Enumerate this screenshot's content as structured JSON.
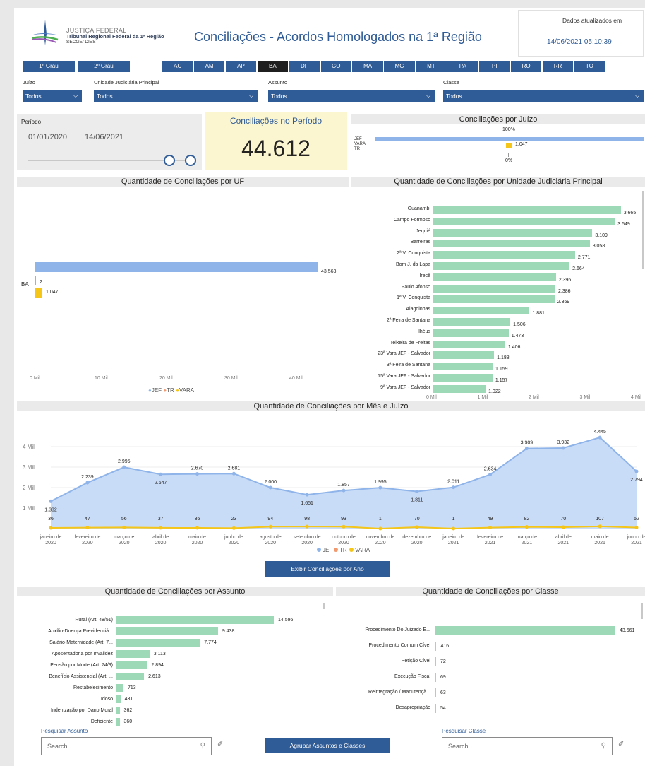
{
  "header": {
    "logo_line1": "JUSTIÇA FEDERAL",
    "logo_line2": "Tribunal Regional Federal da 1ª Região",
    "logo_line3": "SECGE/ DIEST",
    "title": "Conciliações - Acordos Homologados na 1ª Região",
    "updated_label": "Dados atualizados em",
    "updated_value": "14/06/2021 05:10:39"
  },
  "grau_buttons": [
    "1º Grau",
    "2º Grau"
  ],
  "uf_buttons": [
    "AC",
    "AM",
    "AP",
    "BA",
    "DF",
    "GO",
    "MA",
    "MG",
    "MT",
    "PA",
    "PI",
    "RO",
    "RR",
    "TO"
  ],
  "uf_active": "BA",
  "filters": [
    {
      "label": "Juízo",
      "value": "Todos"
    },
    {
      "label": "Unidade Judiciária Principal",
      "value": "Todos"
    },
    {
      "label": "Assunto",
      "value": "Todos"
    },
    {
      "label": "Classe",
      "value": "Todos"
    }
  ],
  "period": {
    "label": "Período",
    "start": "01/01/2020",
    "end": "14/06/2021"
  },
  "kpi": {
    "title": "Conciliações no Período",
    "value": "44.612"
  },
  "juizo_chart": {
    "title": "Conciliações por Juízo",
    "top_pct": "100%",
    "bottom_pct": "0%",
    "categories": [
      "JEF",
      "VARA",
      "TR"
    ],
    "vara_label": "1.047"
  },
  "uf_chart": {
    "title": "Quantidade de Conciliações por UF",
    "category": "BA",
    "labels": [
      "43.563",
      "2",
      "1.047"
    ],
    "ticks": [
      "0 Mil",
      "10 Mil",
      "20 Mil",
      "30 Mil",
      "40 Mil"
    ],
    "legend": [
      "JEF",
      "TR",
      "VARA"
    ]
  },
  "unidade_chart": {
    "title": "Quantidade de Conciliações por Unidade Judiciária Principal",
    "ticks": [
      "0 Mil",
      "1 Mil",
      "2 Mil",
      "3 Mil",
      "4 Mil"
    ],
    "items": [
      {
        "name": "Guanambi",
        "label": "3.665"
      },
      {
        "name": "Campo Formoso",
        "label": "3.549"
      },
      {
        "name": "Jequié",
        "label": "3.109"
      },
      {
        "name": "Barreiras",
        "label": "3.058"
      },
      {
        "name": "2ª V. Conquista",
        "label": "2.771"
      },
      {
        "name": "Bom J. da Lapa",
        "label": "2.664"
      },
      {
        "name": "Irecê",
        "label": "2.396"
      },
      {
        "name": "Paulo Afonso",
        "label": "2.386"
      },
      {
        "name": "1ª V. Conquista",
        "label": "2.369"
      },
      {
        "name": "Alagoinhas",
        "label": "1.881"
      },
      {
        "name": "2ª Feira de Santana",
        "label": "1.506"
      },
      {
        "name": "Ilhéus",
        "label": "1.473"
      },
      {
        "name": "Teixeira de Freitas",
        "label": "1.406"
      },
      {
        "name": "23ª Vara JEF - Salvador",
        "label": "1.188"
      },
      {
        "name": "3ª Feira de Santana",
        "label": "1.159"
      },
      {
        "name": "15ª Vara JEF - Salvador",
        "label": "1.157"
      },
      {
        "name": "9ª Vara JEF - Salvador",
        "label": "1.022"
      }
    ]
  },
  "mes_chart": {
    "title": "Quantidade de Conciliações por Mês e Juízo",
    "yticks": [
      "1 Mil",
      "2 Mil",
      "3 Mil",
      "4 Mil"
    ],
    "months": [
      "janeiro de 2020",
      "fevereiro de 2020",
      "março de 2020",
      "abril de 2020",
      "maio de 2020",
      "junho de 2020",
      "agosto de 2020",
      "setembro de 2020",
      "outubro de 2020",
      "novembro de 2020",
      "dezembro de 2020",
      "janeiro de 2021",
      "fevereiro de 2021",
      "março de 2021",
      "abril de 2021",
      "maio de 2021",
      "junho de 2021"
    ],
    "jef_labels": [
      "1.332",
      "2.239",
      "2.995",
      "2.647",
      "2.670",
      "2.681",
      "2.000",
      "1.651",
      "1.857",
      "1.995",
      "1.811",
      "2.011",
      "2.634",
      "3.909",
      "3.932",
      "4.445",
      "2.794"
    ],
    "vara_labels": [
      "36",
      "47",
      "56",
      "37",
      "36",
      "23",
      "94",
      "98",
      "93",
      "1",
      "70",
      "1",
      "49",
      "82",
      "70",
      "107",
      "52"
    ],
    "legend": [
      "JEF",
      "TR",
      "VARA"
    ]
  },
  "btn_ano": "Exibir Conciliações por Ano",
  "assunto_chart": {
    "title": "Quantidade de Conciliações por Assunto",
    "items": [
      {
        "name": "Rural (Art. 48/51)",
        "label": "14.596"
      },
      {
        "name": "Auxílio-Doença Previdenciá...",
        "label": "9.438"
      },
      {
        "name": "Salário-Maternidade (Art. 7...",
        "label": "7.774"
      },
      {
        "name": "Aposentadoria por Invalidez",
        "label": "3.113"
      },
      {
        "name": "Pensão por Morte (Art. 74/9)",
        "label": "2.894"
      },
      {
        "name": "Benefício Assistencial (Art. ...",
        "label": "2.613"
      },
      {
        "name": "Restabelecimento",
        "label": "713"
      },
      {
        "name": "Idoso",
        "label": "431"
      },
      {
        "name": "Indenização por Dano Moral",
        "label": "362"
      },
      {
        "name": "Deficiente",
        "label": "360"
      }
    ]
  },
  "classe_chart": {
    "title": "Quantidade de Conciliações por Classe",
    "items": [
      {
        "name": "Procedimento Do Juizado E...",
        "label": "43.661"
      },
      {
        "name": "Procedimento Comum Cível",
        "label": "416"
      },
      {
        "name": "Petição Cível",
        "label": "72"
      },
      {
        "name": "Execução Fiscal",
        "label": "69"
      },
      {
        "name": "Reintegração / Manutençã...",
        "label": "63"
      },
      {
        "name": "Desapropriação",
        "label": "54"
      }
    ]
  },
  "search_assunto": {
    "label": "Pesquisar Assunto",
    "placeholder": "Search"
  },
  "search_classe": {
    "label": "Pesquisar Classe",
    "placeholder": "Search"
  },
  "btn_agrupar": "Agrupar Assuntos e Classes",
  "colors": {
    "jef": "#8fb4ea",
    "tr": "#f29a6f",
    "vara": "#f5c518",
    "green": "#9dd9b6",
    "button": "#2f5b96"
  },
  "chart_data": [
    {
      "type": "bar",
      "title": "Quantidade de Conciliações por UF",
      "categories": [
        "BA"
      ],
      "series": [
        {
          "name": "JEF",
          "values": [
            43563
          ]
        },
        {
          "name": "TR",
          "values": [
            2
          ]
        },
        {
          "name": "VARA",
          "values": [
            1047
          ]
        }
      ],
      "xlim": [
        0,
        45000
      ]
    },
    {
      "type": "bar",
      "title": "Quantidade de Conciliações por Unidade Judiciária Principal",
      "categories": [
        "Guanambi",
        "Campo Formoso",
        "Jequié",
        "Barreiras",
        "2ª V. Conquista",
        "Bom J. da Lapa",
        "Irecê",
        "Paulo Afonso",
        "1ª V. Conquista",
        "Alagoinhas",
        "2ª Feira de Santana",
        "Ilhéus",
        "Teixeira de Freitas",
        "23ª Vara JEF - Salvador",
        "3ª Feira de Santana",
        "15ª Vara JEF - Salvador",
        "9ª Vara JEF - Salvador"
      ],
      "values": [
        3665,
        3549,
        3109,
        3058,
        2771,
        2664,
        2396,
        2386,
        2369,
        1881,
        1506,
        1473,
        1406,
        1188,
        1159,
        1157,
        1022
      ],
      "xlim": [
        0,
        4000
      ]
    },
    {
      "type": "area",
      "title": "Quantidade de Conciliações por Mês e Juízo",
      "series": [
        {
          "name": "JEF",
          "values": [
            1332,
            2239,
            2995,
            2647,
            2670,
            2681,
            2000,
            1651,
            1857,
            1995,
            1811,
            2011,
            2634,
            3909,
            3932,
            4445,
            2794
          ]
        },
        {
          "name": "VARA",
          "values": [
            36,
            47,
            56,
            37,
            36,
            23,
            94,
            98,
            93,
            1,
            70,
            1,
            49,
            82,
            70,
            107,
            52
          ]
        }
      ],
      "ylim": [
        0,
        4600
      ]
    },
    {
      "type": "bar",
      "title": "Quantidade de Conciliações por Assunto",
      "values": [
        14596,
        9438,
        7774,
        3113,
        2894,
        2613,
        713,
        431,
        362,
        360
      ]
    },
    {
      "type": "bar",
      "title": "Quantidade de Conciliações por Classe",
      "values": [
        43661,
        416,
        72,
        69,
        63,
        54
      ]
    }
  ]
}
